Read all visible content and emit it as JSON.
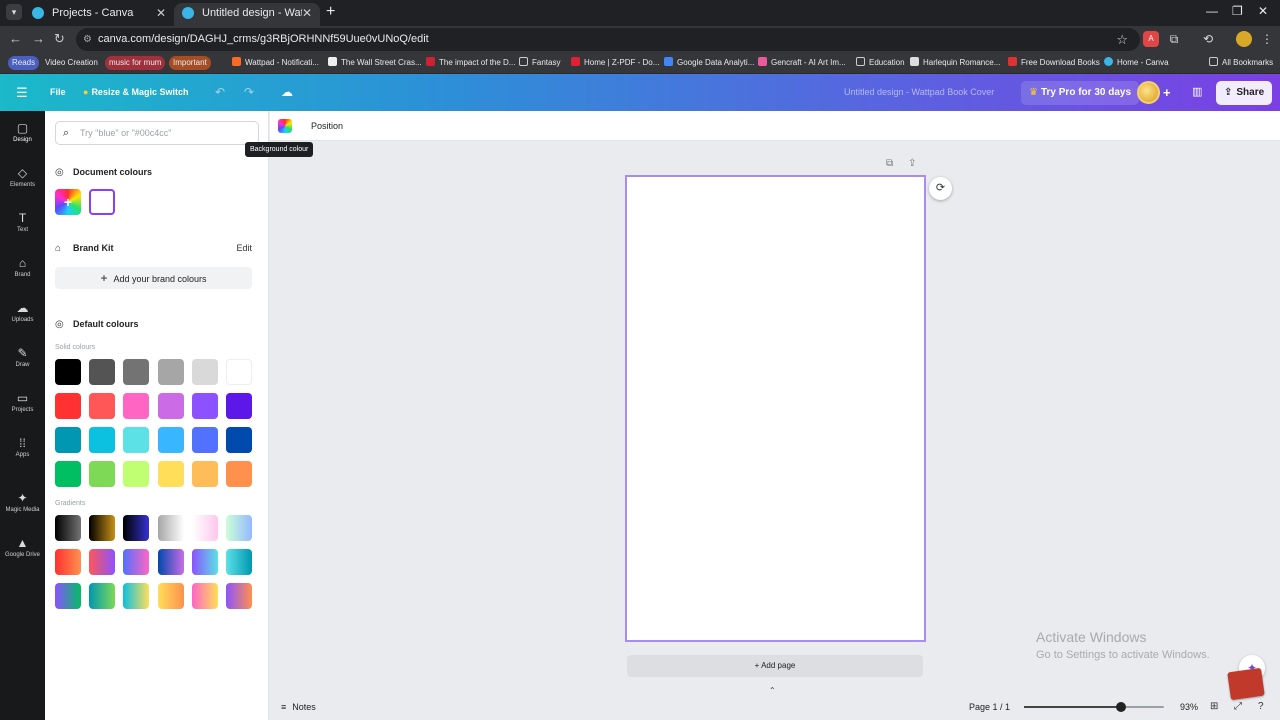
{
  "browser": {
    "tabs": [
      {
        "title": "Projects - Canva"
      },
      {
        "title": "Untitled design - Wattpad Book"
      }
    ],
    "url": "canva.com/design/DAGHJ_crms/g3RBjORHNNf59Uue0vUNoQ/edit",
    "bookmarks": [
      {
        "label": "Reads"
      },
      {
        "label": "Video Creation"
      },
      {
        "label": "music for mum"
      },
      {
        "label": "Important"
      },
      {
        "label": "Wattpad - Notificati..."
      },
      {
        "label": "The Wall Street Cras..."
      },
      {
        "label": "The impact of the D..."
      },
      {
        "label": "Fantasy"
      },
      {
        "label": "Home | Z-PDF - Do..."
      },
      {
        "label": "Google Data Analyti..."
      },
      {
        "label": "Gencraft - AI Art Im..."
      },
      {
        "label": "Education"
      },
      {
        "label": "Harlequin Romance..."
      },
      {
        "label": "Free Download Books"
      },
      {
        "label": "Home - Canva"
      },
      {
        "label": "All Bookmarks"
      }
    ]
  },
  "canva_bar": {
    "file": "File",
    "resize": "Resize & Magic Switch",
    "doc_title": "Untitled design - Wattpad Book Cover",
    "try_pro": "Try Pro for 30 days",
    "share": "Share"
  },
  "rail": [
    {
      "label": "Design",
      "icon": "design-icon"
    },
    {
      "label": "Elements",
      "icon": "elements-icon"
    },
    {
      "label": "Text",
      "icon": "text-icon"
    },
    {
      "label": "Brand",
      "icon": "brand-icon"
    },
    {
      "label": "Uploads",
      "icon": "uploads-icon"
    },
    {
      "label": "Draw",
      "icon": "draw-icon"
    },
    {
      "label": "Projects",
      "icon": "projects-icon"
    },
    {
      "label": "Apps",
      "icon": "apps-icon"
    },
    {
      "label": "Magic Media",
      "icon": "magic-media-icon"
    },
    {
      "label": "Google Drive",
      "icon": "google-drive-icon"
    }
  ],
  "panel": {
    "search_placeholder": "Try \"blue\" or \"#00c4cc\"",
    "document_colours": "Document colours",
    "brand_kit": "Brand Kit",
    "edit": "Edit",
    "add_brand": "Add your brand colours",
    "default_colours": "Default colours",
    "solid_label": "Solid colours",
    "gradients_label": "Gradients",
    "solid": [
      "#000000",
      "#545454",
      "#737373",
      "#a6a6a6",
      "#d9d9d9",
      "#ffffff",
      "#ff3131",
      "#ff5757",
      "#ff66c4",
      "#cb6ce6",
      "#8c52ff",
      "#5e17eb",
      "#0097b2",
      "#0cc0df",
      "#5ce1e6",
      "#38b6ff",
      "#5271ff",
      "#004aad",
      "#00bf63",
      "#7ed957",
      "#c1ff72",
      "#ffde59",
      "#ffbd59",
      "#ff914d"
    ],
    "gradients": [
      [
        "#000000",
        "#737373"
      ],
      [
        "#000000",
        "#c89116"
      ],
      [
        "#000000",
        "#3533cd"
      ],
      [
        "#a6a6a6",
        "#ffffff"
      ],
      [
        "#ffffff",
        "#ffc7ec"
      ],
      [
        "#cdffd8",
        "#94b9ff"
      ],
      [
        "#ff3131",
        "#ff914d"
      ],
      [
        "#ff5757",
        "#8c52ff"
      ],
      [
        "#5170ff",
        "#ff66c4"
      ],
      [
        "#004aad",
        "#cb6ce6"
      ],
      [
        "#8c52ff",
        "#5ce1e6"
      ],
      [
        "#5ce1e6",
        "#0097b2"
      ],
      [
        "#8c52ff",
        "#00bf63"
      ],
      [
        "#0097b2",
        "#7ed957"
      ],
      [
        "#0cc0df",
        "#ffde59"
      ],
      [
        "#ffde59",
        "#ff914d"
      ],
      [
        "#ff66c4",
        "#ffde59"
      ],
      [
        "#8c52ff",
        "#ff914d"
      ]
    ]
  },
  "context": {
    "position": "Position",
    "tooltip": "Background colour"
  },
  "canvas": {
    "add_page": "+ Add page"
  },
  "watermark": {
    "line1": "Activate Windows",
    "line2": "Go to Settings to activate Windows."
  },
  "bottom": {
    "notes": "Notes",
    "page": "Page 1 / 1",
    "zoom_value": 93,
    "zoom_label": "93%"
  }
}
